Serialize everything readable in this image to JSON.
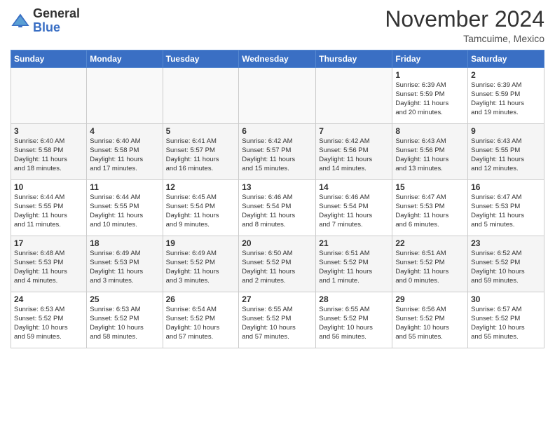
{
  "header": {
    "logo_general": "General",
    "logo_blue": "Blue",
    "month_title": "November 2024",
    "location": "Tamcuime, Mexico"
  },
  "weekdays": [
    "Sunday",
    "Monday",
    "Tuesday",
    "Wednesday",
    "Thursday",
    "Friday",
    "Saturday"
  ],
  "weeks": [
    [
      {
        "day": "",
        "info": ""
      },
      {
        "day": "",
        "info": ""
      },
      {
        "day": "",
        "info": ""
      },
      {
        "day": "",
        "info": ""
      },
      {
        "day": "",
        "info": ""
      },
      {
        "day": "1",
        "info": "Sunrise: 6:39 AM\nSunset: 5:59 PM\nDaylight: 11 hours\nand 20 minutes."
      },
      {
        "day": "2",
        "info": "Sunrise: 6:39 AM\nSunset: 5:59 PM\nDaylight: 11 hours\nand 19 minutes."
      }
    ],
    [
      {
        "day": "3",
        "info": "Sunrise: 6:40 AM\nSunset: 5:58 PM\nDaylight: 11 hours\nand 18 minutes."
      },
      {
        "day": "4",
        "info": "Sunrise: 6:40 AM\nSunset: 5:58 PM\nDaylight: 11 hours\nand 17 minutes."
      },
      {
        "day": "5",
        "info": "Sunrise: 6:41 AM\nSunset: 5:57 PM\nDaylight: 11 hours\nand 16 minutes."
      },
      {
        "day": "6",
        "info": "Sunrise: 6:42 AM\nSunset: 5:57 PM\nDaylight: 11 hours\nand 15 minutes."
      },
      {
        "day": "7",
        "info": "Sunrise: 6:42 AM\nSunset: 5:56 PM\nDaylight: 11 hours\nand 14 minutes."
      },
      {
        "day": "8",
        "info": "Sunrise: 6:43 AM\nSunset: 5:56 PM\nDaylight: 11 hours\nand 13 minutes."
      },
      {
        "day": "9",
        "info": "Sunrise: 6:43 AM\nSunset: 5:55 PM\nDaylight: 11 hours\nand 12 minutes."
      }
    ],
    [
      {
        "day": "10",
        "info": "Sunrise: 6:44 AM\nSunset: 5:55 PM\nDaylight: 11 hours\nand 11 minutes."
      },
      {
        "day": "11",
        "info": "Sunrise: 6:44 AM\nSunset: 5:55 PM\nDaylight: 11 hours\nand 10 minutes."
      },
      {
        "day": "12",
        "info": "Sunrise: 6:45 AM\nSunset: 5:54 PM\nDaylight: 11 hours\nand 9 minutes."
      },
      {
        "day": "13",
        "info": "Sunrise: 6:46 AM\nSunset: 5:54 PM\nDaylight: 11 hours\nand 8 minutes."
      },
      {
        "day": "14",
        "info": "Sunrise: 6:46 AM\nSunset: 5:54 PM\nDaylight: 11 hours\nand 7 minutes."
      },
      {
        "day": "15",
        "info": "Sunrise: 6:47 AM\nSunset: 5:53 PM\nDaylight: 11 hours\nand 6 minutes."
      },
      {
        "day": "16",
        "info": "Sunrise: 6:47 AM\nSunset: 5:53 PM\nDaylight: 11 hours\nand 5 minutes."
      }
    ],
    [
      {
        "day": "17",
        "info": "Sunrise: 6:48 AM\nSunset: 5:53 PM\nDaylight: 11 hours\nand 4 minutes."
      },
      {
        "day": "18",
        "info": "Sunrise: 6:49 AM\nSunset: 5:53 PM\nDaylight: 11 hours\nand 3 minutes."
      },
      {
        "day": "19",
        "info": "Sunrise: 6:49 AM\nSunset: 5:52 PM\nDaylight: 11 hours\nand 3 minutes."
      },
      {
        "day": "20",
        "info": "Sunrise: 6:50 AM\nSunset: 5:52 PM\nDaylight: 11 hours\nand 2 minutes."
      },
      {
        "day": "21",
        "info": "Sunrise: 6:51 AM\nSunset: 5:52 PM\nDaylight: 11 hours\nand 1 minute."
      },
      {
        "day": "22",
        "info": "Sunrise: 6:51 AM\nSunset: 5:52 PM\nDaylight: 11 hours\nand 0 minutes."
      },
      {
        "day": "23",
        "info": "Sunrise: 6:52 AM\nSunset: 5:52 PM\nDaylight: 10 hours\nand 59 minutes."
      }
    ],
    [
      {
        "day": "24",
        "info": "Sunrise: 6:53 AM\nSunset: 5:52 PM\nDaylight: 10 hours\nand 59 minutes."
      },
      {
        "day": "25",
        "info": "Sunrise: 6:53 AM\nSunset: 5:52 PM\nDaylight: 10 hours\nand 58 minutes."
      },
      {
        "day": "26",
        "info": "Sunrise: 6:54 AM\nSunset: 5:52 PM\nDaylight: 10 hours\nand 57 minutes."
      },
      {
        "day": "27",
        "info": "Sunrise: 6:55 AM\nSunset: 5:52 PM\nDaylight: 10 hours\nand 57 minutes."
      },
      {
        "day": "28",
        "info": "Sunrise: 6:55 AM\nSunset: 5:52 PM\nDaylight: 10 hours\nand 56 minutes."
      },
      {
        "day": "29",
        "info": "Sunrise: 6:56 AM\nSunset: 5:52 PM\nDaylight: 10 hours\nand 55 minutes."
      },
      {
        "day": "30",
        "info": "Sunrise: 6:57 AM\nSunset: 5:52 PM\nDaylight: 10 hours\nand 55 minutes."
      }
    ]
  ]
}
